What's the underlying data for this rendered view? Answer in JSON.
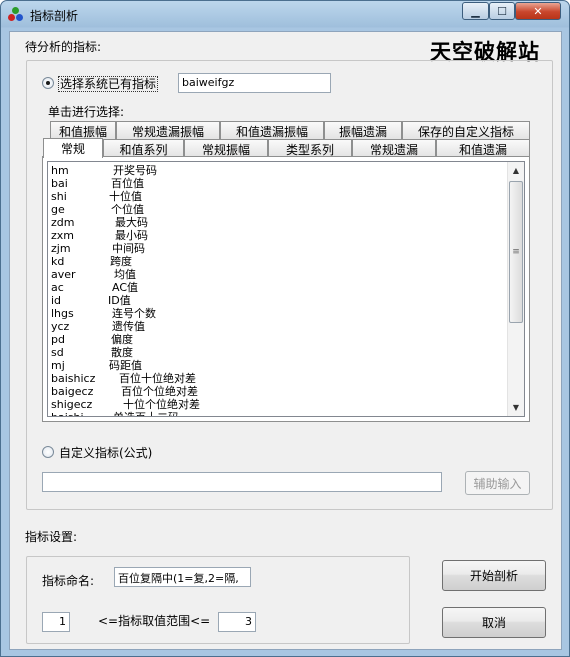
{
  "window": {
    "title": "指标剖析"
  },
  "watermark": "天空破解站",
  "section_to_analyze": {
    "label": "待分析的指标:"
  },
  "option_system": {
    "label": "选择系统已有指标",
    "value": "baiweifgz",
    "selected": true
  },
  "click_hint": "单击进行选择:",
  "tabs_row1": [
    "和值振幅",
    "常规遗漏振幅",
    "和值遗漏振幅",
    "振幅遗漏",
    "保存的自定义指标"
  ],
  "tabs_row2": [
    "常规",
    "和值系列",
    "常规振幅",
    "类型系列",
    "常规遗漏",
    "和值遗漏"
  ],
  "active_tab": "常规",
  "list_items": [
    {
      "code": "hm",
      "desc": "开奖号码"
    },
    {
      "code": "bai",
      "desc": "百位值"
    },
    {
      "code": "shi",
      "desc": "十位值"
    },
    {
      "code": "ge",
      "desc": "个位值"
    },
    {
      "code": "zdm",
      "desc": "最大码"
    },
    {
      "code": "zxm",
      "desc": "最小码"
    },
    {
      "code": "zjm",
      "desc": "中间码"
    },
    {
      "code": "kd",
      "desc": "跨度"
    },
    {
      "code": "aver",
      "desc": "均值"
    },
    {
      "code": "ac",
      "desc": "AC值"
    },
    {
      "code": "id",
      "desc": "ID值"
    },
    {
      "code": "lhgs",
      "desc": "连号个数"
    },
    {
      "code": "ycz",
      "desc": "遗传值"
    },
    {
      "code": "pd",
      "desc": "偏度"
    },
    {
      "code": "sd",
      "desc": "散度"
    },
    {
      "code": "mj",
      "desc": "码距值"
    },
    {
      "code": "baishicz",
      "desc": "百位十位绝对差"
    },
    {
      "code": "baigecz",
      "desc": "百位个位绝对差"
    },
    {
      "code": "shigecz",
      "desc": "十位个位绝对差"
    },
    {
      "code": "baishi",
      "desc": "单选百十二码"
    }
  ],
  "option_custom": {
    "label": "自定义指标(公式)",
    "selected": false,
    "value": ""
  },
  "assist_button": "辅助输入",
  "settings": {
    "label": "指标设置:",
    "name_label": "指标命名:",
    "name_value": "百位复隔中(1=复,2=隔,",
    "range_min": "1",
    "range_label": "<=指标取值范围<=",
    "range_max": "3"
  },
  "start_button": "开始剖析",
  "cancel_button": "取消",
  "colors": {
    "titlebar": "#a8c6e2",
    "close_button": "#c9462c",
    "client_bg": "#f0f0f0"
  }
}
